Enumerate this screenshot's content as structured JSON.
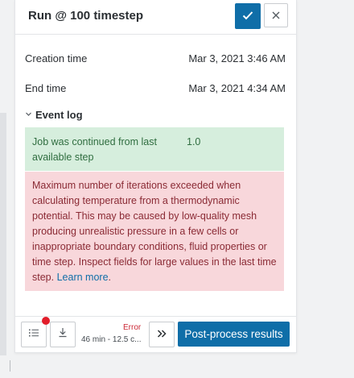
{
  "panel": {
    "title": "Run @ 100 timestep"
  },
  "details": [
    {
      "label": "Creation time",
      "value": "Mar 3, 2021 3:46 AM"
    },
    {
      "label": "End time",
      "value": "Mar 3, 2021 4:34 AM"
    }
  ],
  "event_log": {
    "label": "Event log",
    "success": {
      "text": "Job was continued from last available step",
      "value": "1.0"
    },
    "error": {
      "text": "Maximum number of iterations exceeded when calculating temperature from a thermodynamic potential. This may be caused by low-quality mesh producing unrealistic pressure in a few cells or inappropriate boundary conditions, fluid properties or time step. Inspect fields for large values in the last time step.",
      "link": "Learn more",
      "after_link": "."
    }
  },
  "footer": {
    "status": "Error",
    "duration": "46 min - 12.5 c...",
    "post_process_label": "Post-process results"
  },
  "icons": {
    "confirm": "check-icon",
    "close": "close-icon",
    "collapse": "chevron-down-icon",
    "list": "list-icon",
    "download": "download-icon",
    "expand": "double-chevron-right-icon"
  },
  "colors": {
    "primary": "#0f6ea8",
    "success_bg": "#d6eedd",
    "error_bg": "#f8d7db",
    "error_text": "#cc2a36",
    "notification_dot": "#e21d2a"
  }
}
